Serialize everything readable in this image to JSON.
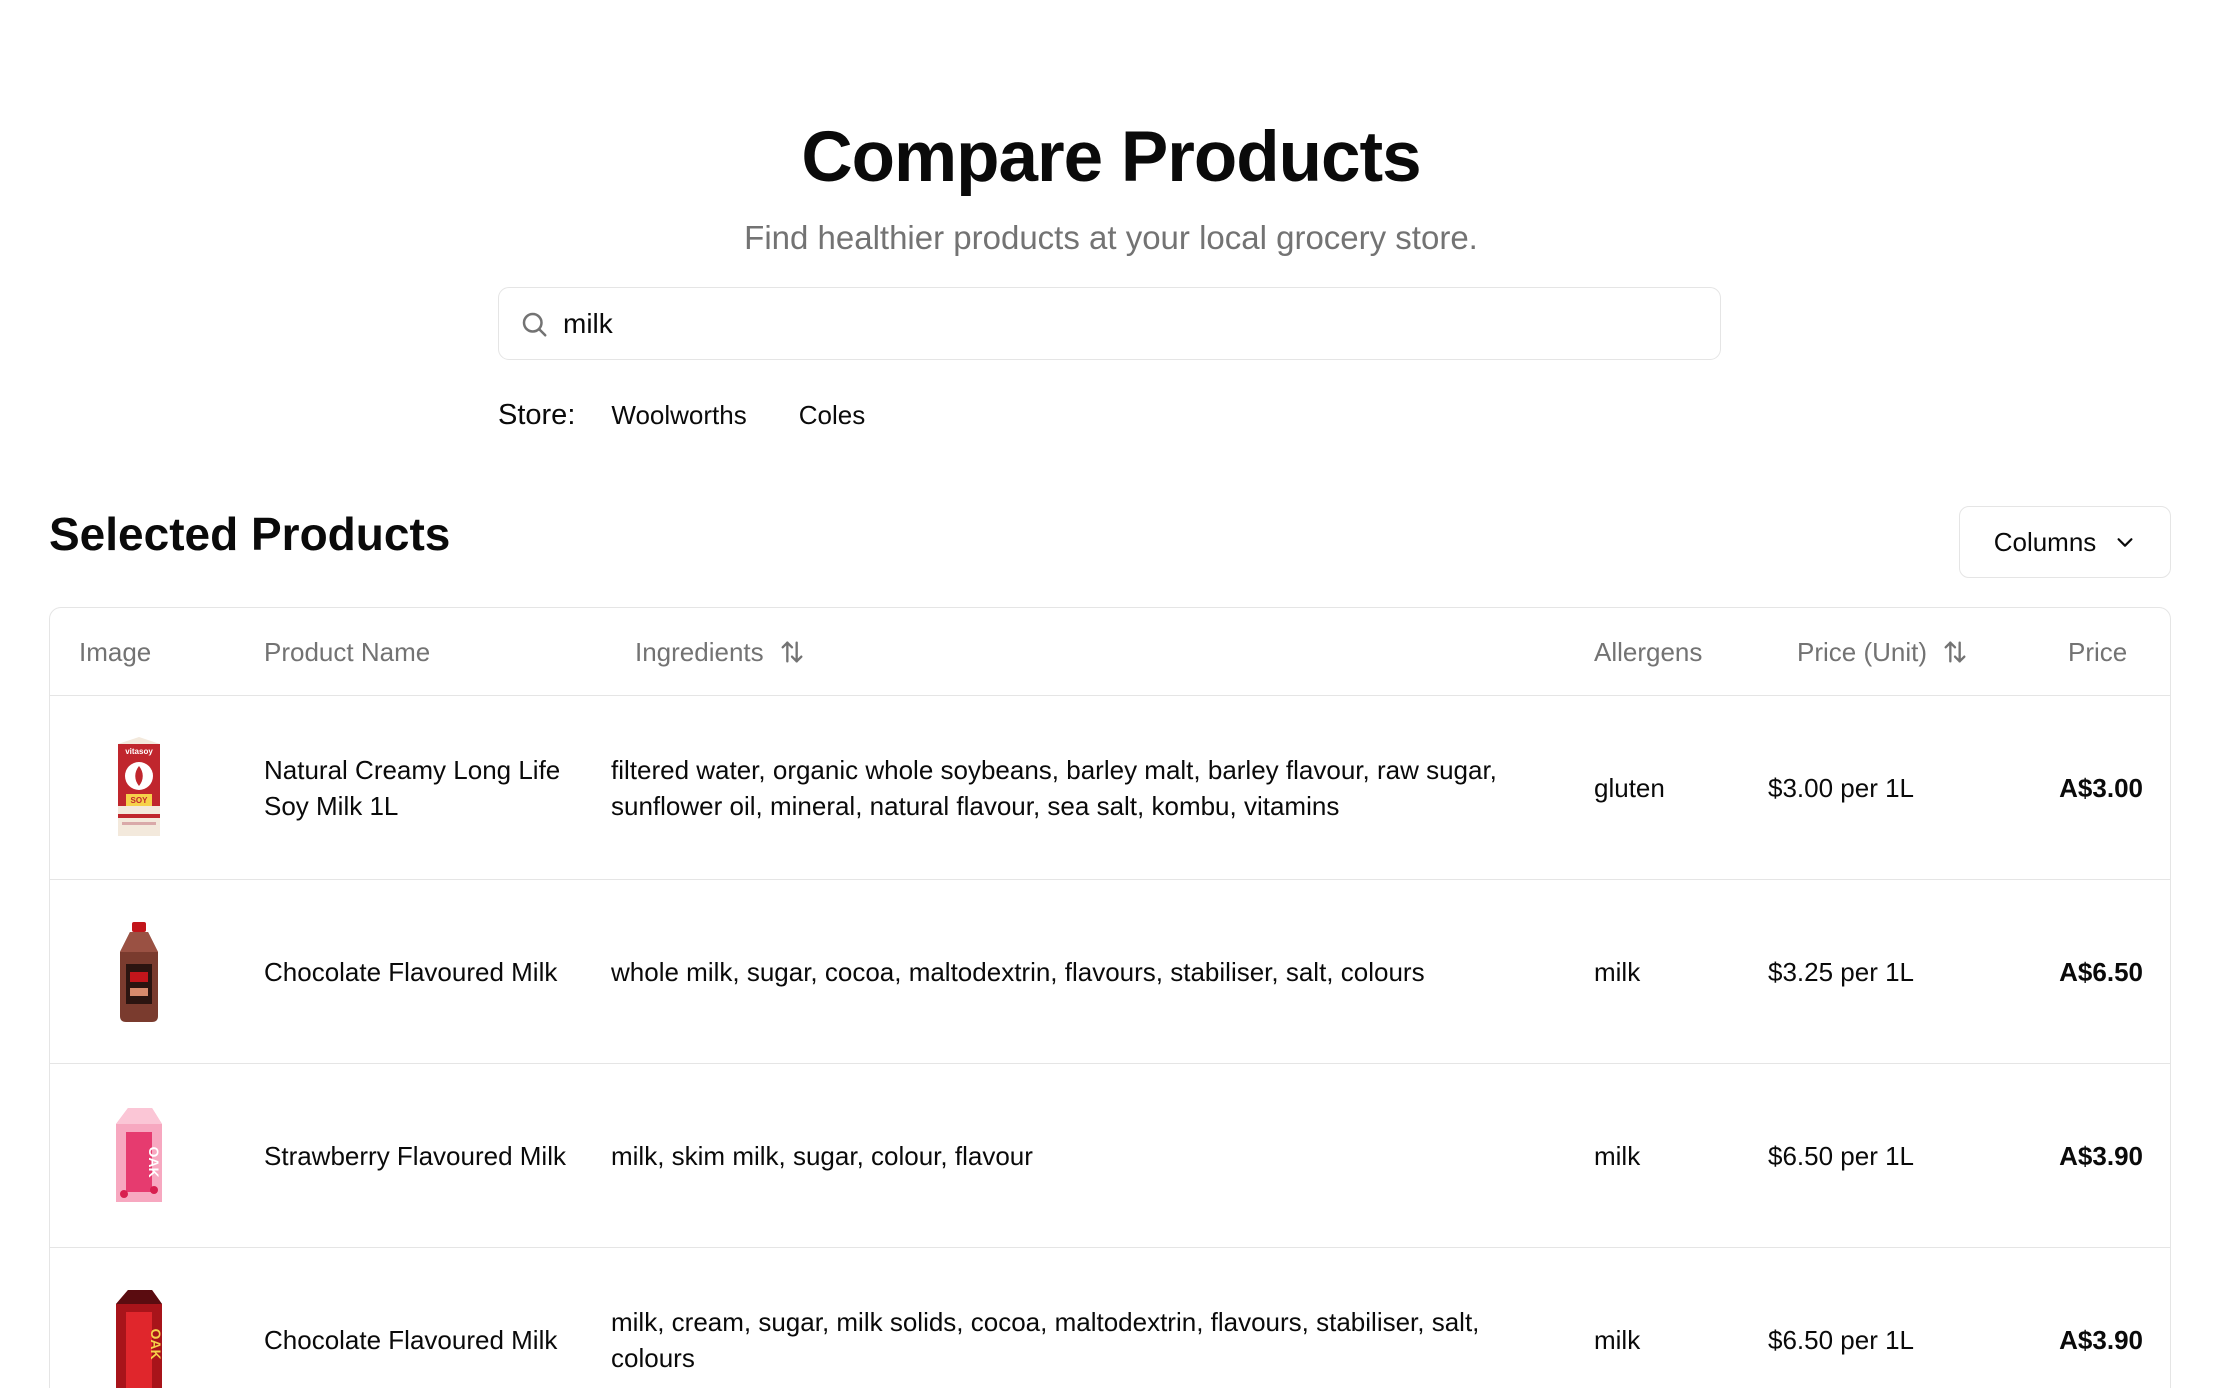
{
  "header": {
    "title": "Compare Products",
    "subtitle": "Find healthier products at your local grocery store."
  },
  "search": {
    "value": "milk",
    "icon": "search-icon"
  },
  "store": {
    "label": "Store:",
    "options": [
      "Woolworths",
      "Coles"
    ]
  },
  "selected": {
    "title": "Selected Products",
    "columns_button": "Columns"
  },
  "table": {
    "headers": {
      "image": "Image",
      "name": "Product Name",
      "ingredients": "Ingredients",
      "allergens": "Allergens",
      "unit_price": "Price (Unit)",
      "price": "Price"
    },
    "rows": [
      {
        "name": "Natural Creamy Long Life Soy Milk 1L",
        "ingredients": "filtered water, organic whole soybeans, barley malt, barley flavour, raw sugar, sunflower oil, mineral, natural flavour, sea salt, kombu, vitamins",
        "allergens": "gluten",
        "unit_price": "$3.00 per 1L",
        "price": "A$3.00",
        "image": "soy-milk-carton",
        "brand_mark": "vitasoy",
        "product_mark": "SOY"
      },
      {
        "name": "Chocolate Flavoured Milk",
        "ingredients": "whole milk, sugar, cocoa, maltodextrin, flavours, stabiliser, salt, colours",
        "allergens": "milk",
        "unit_price": "$3.25 per 1L",
        "price": "A$6.50",
        "image": "chocolate-milk-bottle"
      },
      {
        "name": "Strawberry Flavoured Milk",
        "ingredients": "milk, skim milk, sugar, colour, flavour",
        "allergens": "milk",
        "unit_price": "$6.50 per 1L",
        "price": "A$3.90",
        "image": "strawberry-milk-carton",
        "brand_mark": "OAK"
      },
      {
        "name": "Chocolate Flavoured Milk",
        "ingredients": "milk, cream, sugar, milk solids, cocoa, maltodextrin, flavours, stabiliser, salt, colours",
        "allergens": "milk",
        "unit_price": "$6.50 per 1L",
        "price": "A$3.90",
        "image": "chocolate-milk-carton",
        "brand_mark": "OAK"
      }
    ]
  }
}
